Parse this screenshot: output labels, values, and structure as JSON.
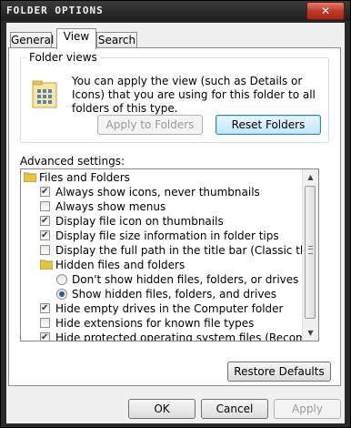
{
  "window": {
    "title": "Folder Options",
    "close_glyph": "✕"
  },
  "tabs": [
    {
      "label": "General",
      "active": false
    },
    {
      "label": "View",
      "active": true
    },
    {
      "label": "Search",
      "active": false
    }
  ],
  "folder_views": {
    "group_title": "Folder views",
    "icon": "folder-grid-icon",
    "description": "You can apply the view (such as Details or Icons) that you are using for this folder to all folders of this type.",
    "apply_button": "Apply to Folders",
    "reset_button": "Reset Folders"
  },
  "advanced": {
    "label": "Advanced settings:",
    "items": [
      {
        "type": "folder",
        "label": "Files and Folders"
      },
      {
        "type": "checkbox",
        "checked": true,
        "label": "Always show icons, never thumbnails"
      },
      {
        "type": "checkbox",
        "checked": false,
        "label": "Always show menus"
      },
      {
        "type": "checkbox",
        "checked": true,
        "label": "Display file icon on thumbnails"
      },
      {
        "type": "checkbox",
        "checked": true,
        "label": "Display file size information in folder tips"
      },
      {
        "type": "checkbox",
        "checked": false,
        "label": "Display the full path in the title bar (Classic theme only)"
      },
      {
        "type": "folder",
        "label": "Hidden files and folders"
      },
      {
        "type": "radio",
        "selected": false,
        "label": "Don't show hidden files, folders, or drives"
      },
      {
        "type": "radio",
        "selected": true,
        "label": "Show hidden files, folders, and drives"
      },
      {
        "type": "checkbox",
        "checked": true,
        "label": "Hide empty drives in the Computer folder"
      },
      {
        "type": "checkbox",
        "checked": false,
        "label": "Hide extensions for known file types"
      },
      {
        "type": "checkbox",
        "checked": true,
        "label": "Hide protected operating system files (Recommended)"
      }
    ]
  },
  "restore_button": "Restore Defaults",
  "footer": {
    "ok": "OK",
    "cancel": "Cancel",
    "apply": "Apply"
  },
  "colors": {
    "titlebar": "#2a2a2a",
    "close": "#c0392b",
    "focus_blue": "#3c7fb1",
    "folder_yellow": "#e8c24a"
  }
}
